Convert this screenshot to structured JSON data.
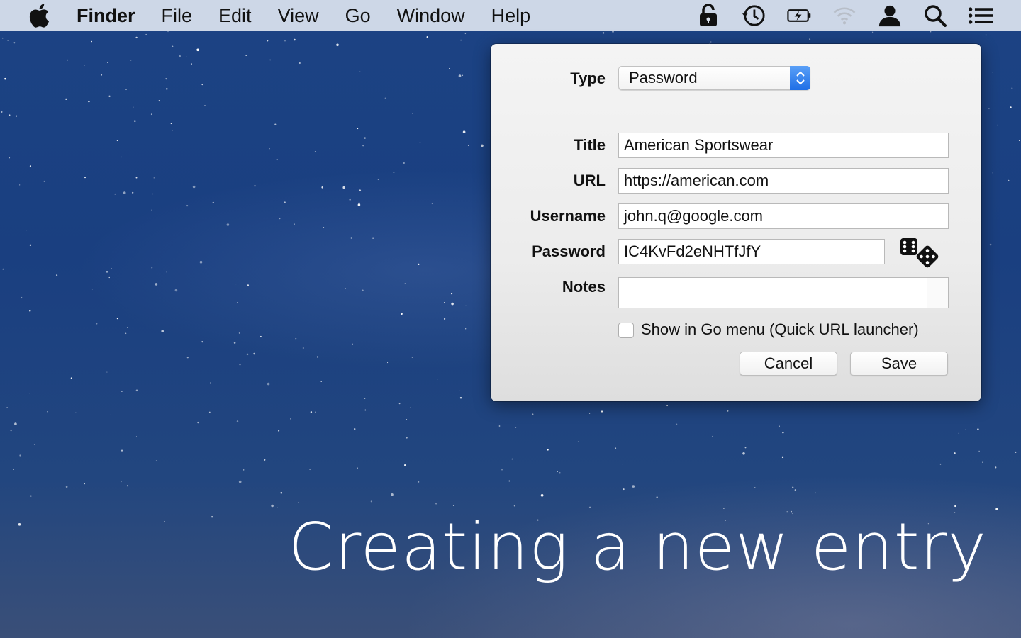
{
  "menubar": {
    "items": [
      {
        "label": "Finder"
      },
      {
        "label": "File"
      },
      {
        "label": "Edit"
      },
      {
        "label": "View"
      },
      {
        "label": "Go"
      },
      {
        "label": "Window"
      },
      {
        "label": "Help"
      }
    ],
    "status_icons": [
      "lock-icon",
      "time-machine-icon",
      "battery-charging-icon",
      "wifi-icon",
      "user-icon",
      "search-icon",
      "list-icon"
    ]
  },
  "dialog": {
    "type_label": "Type",
    "type_value": "Password",
    "title_label": "Title",
    "title_value": "American Sportswear",
    "url_label": "URL",
    "url_value": "https://american.com",
    "username_label": "Username",
    "username_value": "john.q@google.com",
    "password_label": "Password",
    "password_value": "IC4KvFd2eNHTfJfY",
    "notes_label": "Notes",
    "notes_value": "",
    "show_in_go_label": "Show in Go menu (Quick URL launcher)",
    "show_in_go_checked": false,
    "cancel_label": "Cancel",
    "save_label": "Save"
  },
  "caption": "Creating a new entry",
  "colors": {
    "accent": "#1f6fe6",
    "menubar": "#dce4f0",
    "wallpaper": "#1a3f80"
  }
}
